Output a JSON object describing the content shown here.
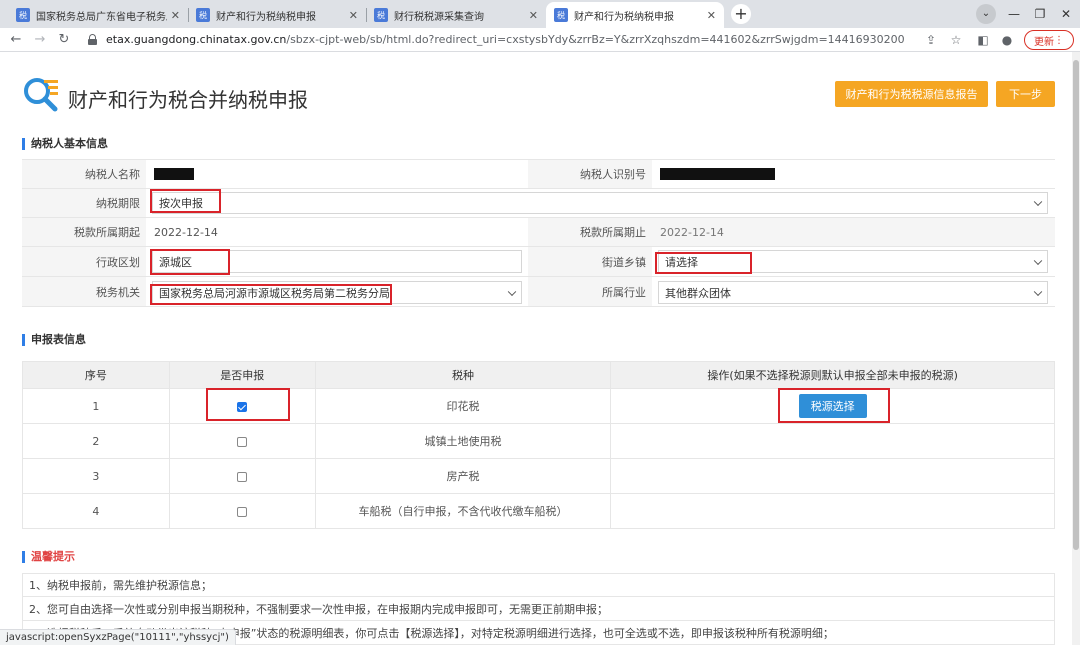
{
  "browser": {
    "tabs": [
      {
        "title": "国家税务总局广东省电子税务局",
        "favicon": "税"
      },
      {
        "title": "财产和行为税纳税申报",
        "favicon": "税"
      },
      {
        "title": "财行税税源采集查询",
        "favicon": "税"
      },
      {
        "title": "财产和行为税纳税申报",
        "favicon": "税"
      }
    ],
    "active_tab": 3,
    "url_host": "etax.guangdong.chinatax.gov.cn",
    "url_path": "/sbzx-cjpt-web/sb/html.do?redirect_uri=cxstysbYdy&zrrBz=Y&zrrXzqhszdm=441602&zrrSwjgdm=14416930200",
    "update_label": "更新",
    "status_text": "javascript:openSyxzPage(\"10111\",\"yhssycj\")"
  },
  "header": {
    "title": "财产和行为税合并纳税申报",
    "report_button": "财产和行为税税源信息报告",
    "next_button": "下一步"
  },
  "basic_info": {
    "section_title": "纳税人基本信息",
    "taxpayer_name_label": "纳税人名称",
    "taxpayer_id_label": "纳税人识别号",
    "period_label": "纳税期限",
    "period_value": "按次申报",
    "start_label": "税款所属期起",
    "start_value": "2022-12-14",
    "end_label": "税款所属期止",
    "end_value": "2022-12-14",
    "district_label": "行政区划",
    "district_value": "源城区",
    "street_label": "街道乡镇",
    "street_value": "请选择",
    "tax_office_label": "税务机关",
    "tax_office_value": "国家税务总局河源市源城区税务局第二税务分局",
    "industry_label": "所属行业",
    "industry_value": "其他群众团体"
  },
  "declaration": {
    "section_title": "申报表信息",
    "headers": [
      "序号",
      "是否申报",
      "税种",
      "操作(如果不选择税源则默认申报全部未申报的税源)"
    ],
    "rows": [
      {
        "no": "1",
        "checked": true,
        "tax": "印花税",
        "action": "税源选择"
      },
      {
        "no": "2",
        "checked": false,
        "tax": "城镇土地使用税",
        "action": ""
      },
      {
        "no": "3",
        "checked": false,
        "tax": "房产税",
        "action": ""
      },
      {
        "no": "4",
        "checked": false,
        "tax": "车船税（自行申报，不含代收代缴车船税）",
        "action": ""
      }
    ]
  },
  "tips": {
    "section_title": "温馨提示",
    "items": [
      "1、纳税申报前，需先维护税源信息；",
      "2、您可自由选择一次性或分别申报当期税种，不强制要求一次性申报，在申报期内完成申报即可，无需更正前期申报；",
      "3、选择税种后，系统自动带出该税种“未申报”状态的税源明细表，你可点击【税源选择】，对特定税源明细进行选择，也可全选或不选，即申报该税种所有税源明细；"
    ]
  },
  "colors": {
    "accent_orange": "#f5a623",
    "accent_blue": "#2f8fd8",
    "highlight_red": "#d9232a"
  }
}
